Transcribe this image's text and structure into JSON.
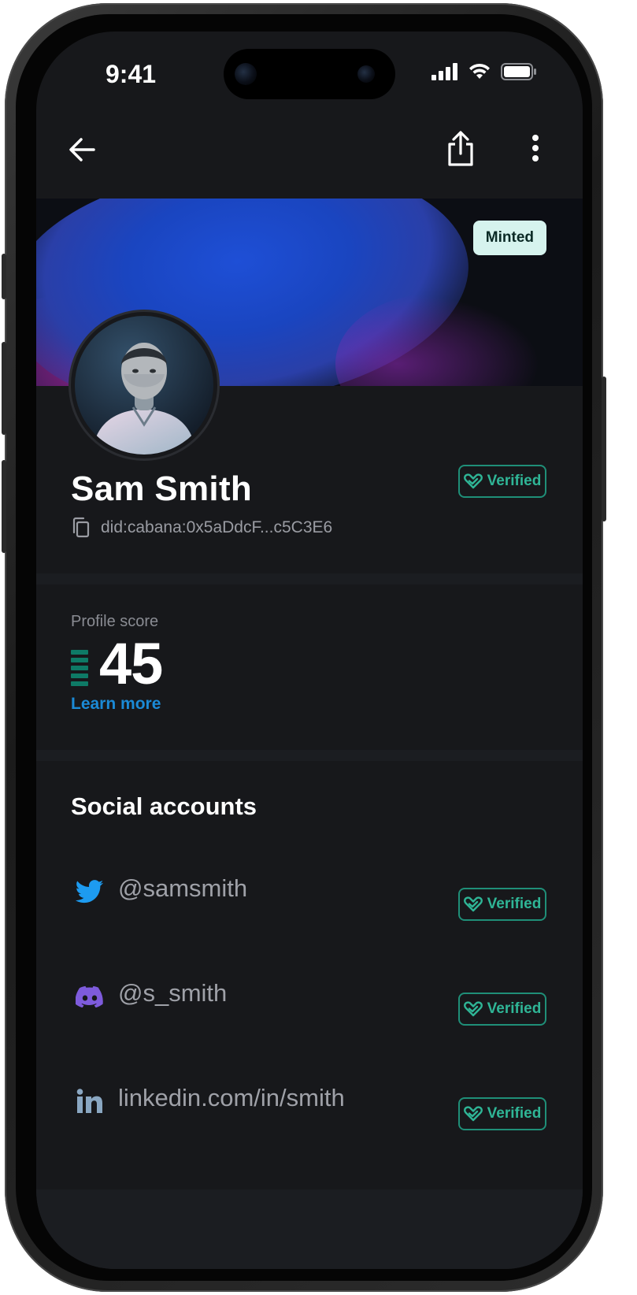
{
  "status_bar": {
    "time": "9:41"
  },
  "top_bar": {
    "back_icon": "arrow-left-icon",
    "share_icon": "share-icon",
    "more_icon": "more-vertical-icon"
  },
  "banner": {
    "minted_label": "Minted"
  },
  "profile": {
    "name": "Sam Smith",
    "did": "did:cabana:0x5aDdcF...c5C3E6",
    "verified_label": "Verified"
  },
  "score": {
    "label": "Profile score",
    "value": "45",
    "learn_more": "Learn more"
  },
  "social": {
    "title": "Social accounts",
    "accounts": [
      {
        "platform": "twitter",
        "icon": "twitter-icon",
        "handle": "@samsmith",
        "verified_label": "Verified"
      },
      {
        "platform": "discord",
        "icon": "discord-icon",
        "handle": "@s_smith",
        "verified_label": "Verified"
      },
      {
        "platform": "linkedin",
        "icon": "linkedin-icon",
        "handle": "linkedin.com/in/smith",
        "verified_label": "Verified"
      }
    ]
  },
  "colors": {
    "background": "#17181b",
    "accent_green": "#2fb596",
    "link_blue": "#1b8ad6",
    "minted_bg": "#d6f3ee"
  }
}
